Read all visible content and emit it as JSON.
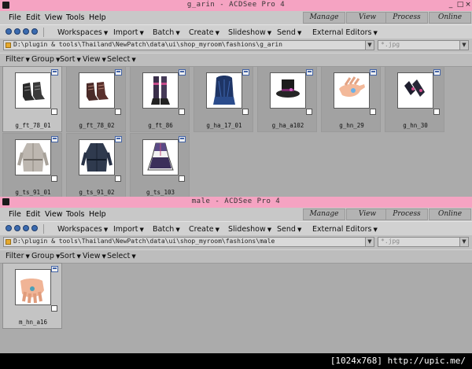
{
  "windows": [
    {
      "title": "g_arin - ACDSee Pro 4",
      "menu": {
        "file": "File",
        "edit": "Edit",
        "view": "View",
        "tools": "Tools",
        "help": "Help"
      },
      "modes": {
        "manage": "Manage",
        "view": "View",
        "process": "Process",
        "online": "Online"
      },
      "toolbar": {
        "workspaces": "Workspaces",
        "import": "Import",
        "batch": "Batch",
        "create": "Create",
        "slideshow": "Slideshow",
        "send": "Send",
        "external_editors": "External Editors"
      },
      "path": "D:\\plugin & tools\\Thailand\\NewPatch\\data\\ui\\shop_myroom\\fashions\\g_arin",
      "filter_placeholder": "*.jpg",
      "viewbar": {
        "filter": "Filter",
        "group": "Group",
        "sort": "Sort",
        "view": "View",
        "select": "Select"
      },
      "files": [
        "g_ft_78_01",
        "g_ft_78_02",
        "g_ft_86",
        "g_ha_17_01",
        "g_ha_a102",
        "g_hn_29",
        "g_hn_30",
        "g_ts_91_01",
        "g_ts_91_02",
        "g_ts_103"
      ]
    },
    {
      "title": "male - ACDSee Pro 4",
      "menu": {
        "file": "File",
        "edit": "Edit",
        "view": "View",
        "tools": "Tools",
        "help": "Help"
      },
      "modes": {
        "manage": "Manage",
        "view": "View",
        "process": "Process",
        "online": "Online"
      },
      "toolbar": {
        "workspaces": "Workspaces",
        "import": "Import",
        "batch": "Batch",
        "create": "Create",
        "slideshow": "Slideshow",
        "send": "Send",
        "external_editors": "External Editors"
      },
      "path": "D:\\plugin & tools\\Thailand\\NewPatch\\data\\ui\\shop_myroom\\fashions\\male",
      "filter_placeholder": "*.jpg",
      "viewbar": {
        "filter": "Filter",
        "group": "Group",
        "sort": "Sort",
        "view": "View",
        "select": "Select"
      },
      "files": [
        "m_hn_a16"
      ]
    }
  ],
  "status": {
    "text": "[1024x768] http://upic.me/"
  },
  "colors": {
    "titlebar": "#f5a3c2",
    "window_bg": "#ababab",
    "menubar": "#c8c8c8"
  }
}
